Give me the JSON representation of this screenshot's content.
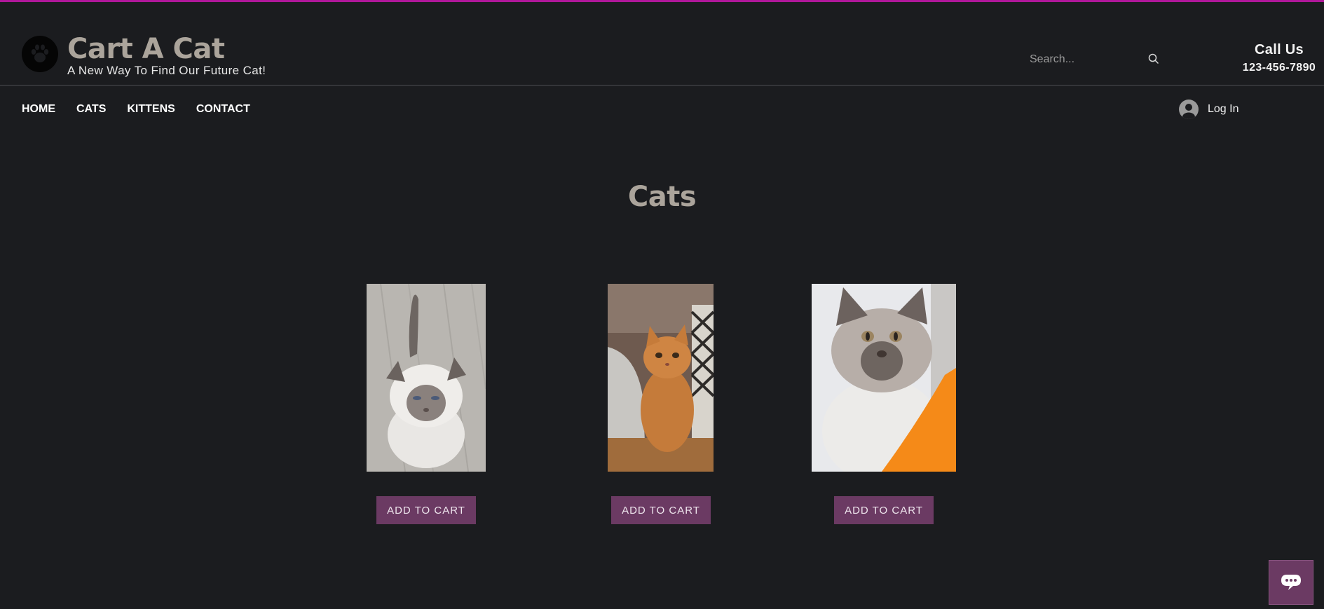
{
  "brand": {
    "title": "Cart A Cat",
    "tagline": "A New Way To Find Our Future Cat!",
    "logo_icon": "paw-icon"
  },
  "search": {
    "placeholder": "Search...",
    "icon": "search-icon"
  },
  "contact": {
    "label": "Call Us",
    "phone": "123-456-7890"
  },
  "nav": {
    "items": [
      {
        "label": "HOME"
      },
      {
        "label": "CATS"
      },
      {
        "label": "KITTENS"
      },
      {
        "label": "CONTACT"
      }
    ]
  },
  "login": {
    "label": "Log In",
    "icon": "user-avatar-icon"
  },
  "page": {
    "title": "Cats"
  },
  "products": [
    {
      "image": "siamese-kitten-photo",
      "button_label": "ADD TO CART"
    },
    {
      "image": "orange-tabby-cat-photo",
      "button_label": "ADD TO CART"
    },
    {
      "image": "british-shorthair-cat-photo",
      "button_label": "ADD TO CART"
    }
  ],
  "chat": {
    "icon": "chat-bubble-icon"
  },
  "colors": {
    "background": "#1b1c1f",
    "accent_bar": "#b0179a",
    "button": "#6b3a63",
    "heading": "#aba49b"
  }
}
